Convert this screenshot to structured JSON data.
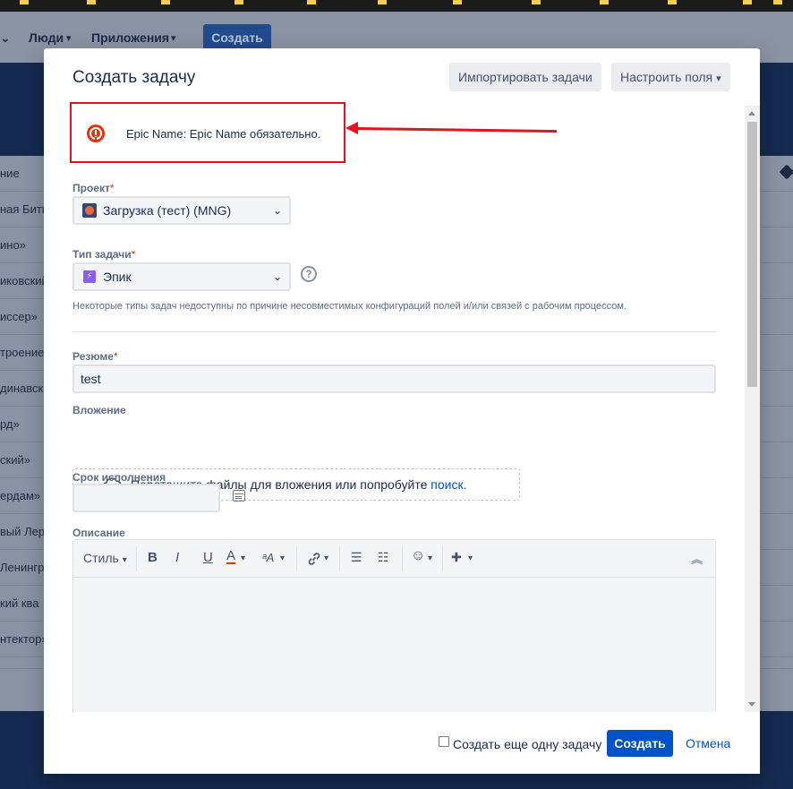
{
  "background": {
    "nav": {
      "people": "Люди",
      "apps": "Приложения",
      "create": "Создать"
    },
    "list_rows": [
      "ние",
      "ная Бить",
      "ино»",
      "иковский",
      "иссер»",
      "троение",
      "динавск",
      "рд»",
      "ский»",
      "ердам»",
      "вый Лер",
      "Ленингр",
      "кий ква",
      "нтектор»"
    ]
  },
  "modal": {
    "title": "Создать задачу",
    "import_button": "Импортировать задачи",
    "configure_fields_button": "Настроить поля",
    "error": {
      "message": "Epic Name: Epic Name обязательно."
    },
    "project": {
      "label": "Проект",
      "value": "Загрузка (тест) (MNG)"
    },
    "issue_type": {
      "label": "Тип задачи",
      "value": "Эпик",
      "hint": "Некоторые типы задач недоступны по причине несовместимых конфигураций полей и/или связей с рабочим процессом."
    },
    "summary": {
      "label": "Резюме",
      "value": "test"
    },
    "attachment": {
      "label": "Вложение",
      "text": "Перетащите файлы для вложения или попробуйте",
      "link": "поиск."
    },
    "due_date": {
      "label": "Срок исполнения"
    },
    "description": {
      "label": "Описание",
      "toolbar": {
        "style": "Стиль",
        "bold": "B",
        "italic": "I",
        "underline": "U",
        "color": "A",
        "more_text": "ᵃA",
        "link": "🔗",
        "bullets": "☰",
        "numbered": "☷",
        "emoji": "☺",
        "insert": "✚",
        "collapse": "︽"
      }
    },
    "footer": {
      "create_another": "Создать еще одну задачу",
      "create": "Создать",
      "cancel": "Отмена"
    }
  }
}
